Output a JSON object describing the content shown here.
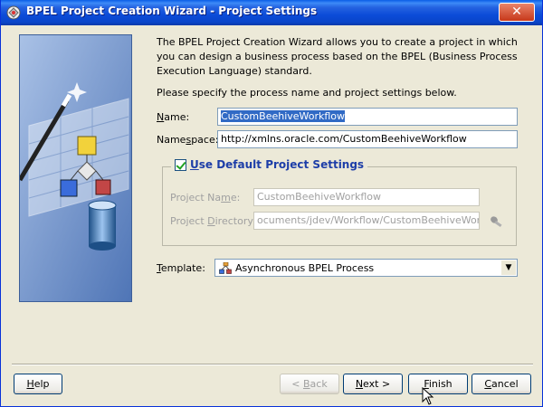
{
  "window": {
    "title": "BPEL Project Creation Wizard - Project Settings",
    "close_glyph": "✕"
  },
  "intro": {
    "description": "The BPEL Project Creation Wizard allows you to create a project in which you can design a business process based on the BPEL (Business Process Execution Language) standard.",
    "instruction": "Please specify the process name and project settings below."
  },
  "form": {
    "name": {
      "label_mnemonic": "N",
      "label_rest": "ame:",
      "value": "CustomBeehiveWorkflow"
    },
    "namespace": {
      "label_pre": "Name",
      "label_mnemonic": "s",
      "label_rest": "pace:",
      "value": "http://xmlns.oracle.com/CustomBeehiveWorkflow"
    },
    "default_settings": {
      "label_mnemonic": "U",
      "label_rest": "se Default Project Settings",
      "checked": true
    },
    "project_name": {
      "label_pre": "Project Na",
      "label_mnemonic": "m",
      "label_rest": "e:",
      "value": "CustomBeehiveWorkflow"
    },
    "project_directory": {
      "label_pre": "Project ",
      "label_mnemonic": "D",
      "label_rest": "irectory:",
      "value": "ocuments/jdev/Workflow/CustomBeehiveWorkflow/"
    },
    "template": {
      "label_mnemonic": "T",
      "label_rest": "emplate:",
      "value": "Asynchronous BPEL Process"
    }
  },
  "buttons": {
    "help": {
      "mnemonic": "H",
      "rest": "elp"
    },
    "back": {
      "pre": "< ",
      "mnemonic": "B",
      "rest": "ack"
    },
    "next": {
      "mnemonic": "N",
      "rest": "ext >"
    },
    "finish": {
      "mnemonic": "F",
      "rest": "inish"
    },
    "cancel": {
      "mnemonic": "C",
      "rest": "ancel"
    }
  },
  "colors": {
    "titlebar": "#0a4bd8",
    "selection": "#316ac5",
    "group_legend": "#1d3ea8",
    "disabled_text": "#a0a0a0"
  }
}
